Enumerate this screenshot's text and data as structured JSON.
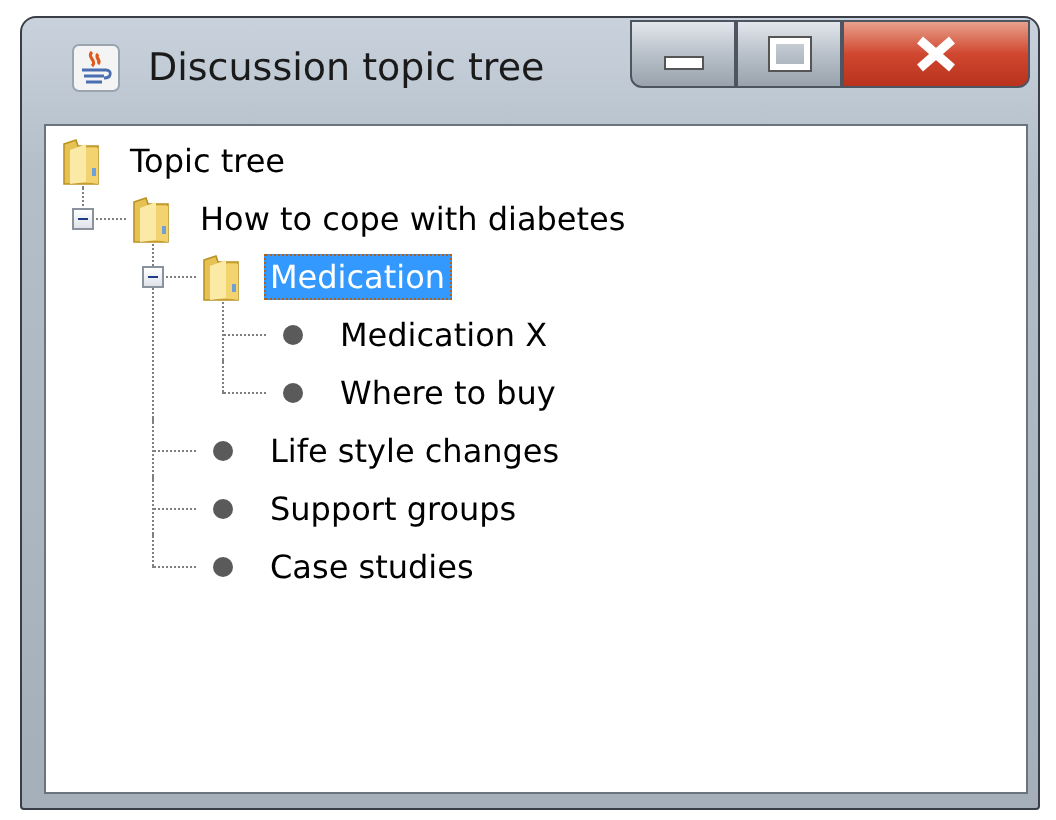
{
  "window": {
    "title": "Discussion topic tree"
  },
  "tree": {
    "label": "Topic tree",
    "kind": "folder",
    "selected": false,
    "children": [
      {
        "label": "How to cope with diabetes",
        "kind": "folder",
        "expanded": true,
        "selected": false,
        "children": [
          {
            "label": "Medication",
            "kind": "folder",
            "expanded": true,
            "selected": true,
            "children": [
              {
                "label": "Medication X",
                "kind": "leaf",
                "selected": false
              },
              {
                "label": "Where to buy",
                "kind": "leaf",
                "selected": false
              }
            ]
          },
          {
            "label": "Life style changes",
            "kind": "leaf",
            "selected": false
          },
          {
            "label": "Support groups",
            "kind": "leaf",
            "selected": false
          },
          {
            "label": "Case studies",
            "kind": "leaf",
            "selected": false
          }
        ]
      }
    ]
  }
}
